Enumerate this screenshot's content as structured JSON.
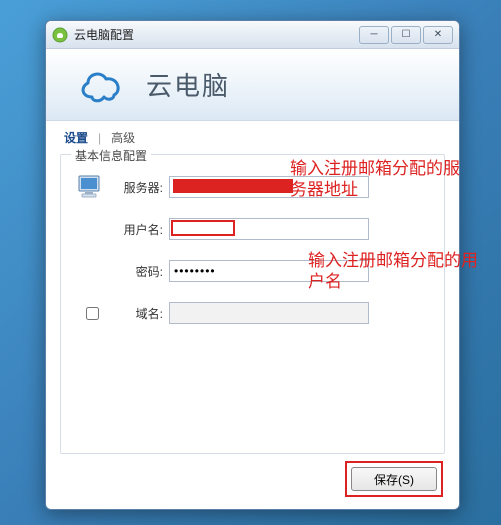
{
  "window": {
    "title": "云电脑配置"
  },
  "header": {
    "brand": "云电脑"
  },
  "tabs": {
    "settings": "设置",
    "advanced": "高级"
  },
  "fieldset": {
    "legend": "基本信息配置"
  },
  "form": {
    "server_label": "服务器:",
    "server_value": "",
    "username_label": "用户名:",
    "username_value": "",
    "password_label": "密码:",
    "password_value": "••••••••",
    "domain_label": "域名:",
    "domain_value": ""
  },
  "buttons": {
    "save": "保存(S)"
  },
  "annotations": {
    "server_hint": "输入注册邮箱分配的服务器地址",
    "username_hint": "输入注册邮箱分配的用户名"
  }
}
